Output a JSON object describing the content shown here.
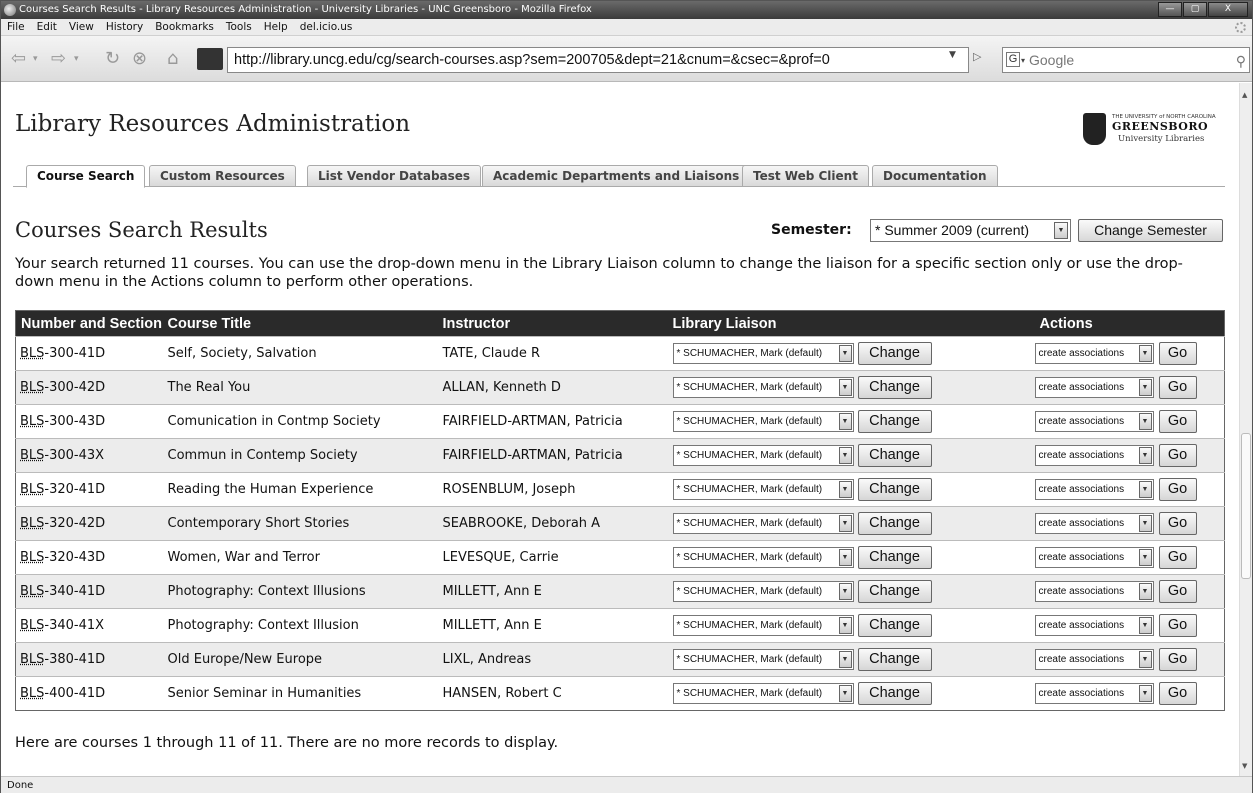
{
  "window": {
    "title": "Courses Search Results - Library Resources Administration - University Libraries - UNC Greensboro - Mozilla Firefox",
    "min": "—",
    "max": "▢",
    "close": "X"
  },
  "menu": [
    "File",
    "Edit",
    "View",
    "History",
    "Bookmarks",
    "Tools",
    "Help",
    "del.icio.us"
  ],
  "nav": {
    "back": "⇦",
    "forward": "⇨",
    "reload": "↻",
    "stop": "⊗",
    "home": "⌂",
    "url": "http://library.uncg.edu/cg/search-courses.asp?sem=200705&dept=21&cnum=&csec=&prof=0",
    "search_placeholder": "Google",
    "search_engine_icon": "G",
    "search_icon": "⚲"
  },
  "header": {
    "site_title": "Library Resources Administration",
    "logo": {
      "university": "THE UNIVERSITY of NORTH CAROLINA",
      "name": "GREENSBORO",
      "sub": "University Libraries"
    }
  },
  "tabs": [
    {
      "label": "Course Search",
      "active": true
    },
    {
      "label": "Custom Resources",
      "active": false
    },
    {
      "label": "List Vendor Databases",
      "active": false
    },
    {
      "label": "Academic Departments and Liaisons",
      "active": false
    },
    {
      "label": "Test Web Client",
      "active": false
    },
    {
      "label": "Documentation",
      "active": false
    }
  ],
  "page": {
    "heading": "Courses Search Results",
    "semester_label": "Semester:",
    "semester_value": "* Summer 2009 (current)",
    "change_semester": "Change Semester",
    "intro": "Your search returned 11 courses. You can use the drop-down menu in the Library Liaison column to change the liaison for a specific section only or use the drop-down menu in the Actions column to perform other operations.",
    "footer": "Here are courses 1 through 11 of 11. There are no more records to display."
  },
  "table": {
    "headers": [
      "Number and Section",
      "Course Title",
      "Instructor",
      "Library Liaison",
      "Actions"
    ],
    "liaison_value": "* SCHUMACHER, Mark (default)",
    "change_label": "Change",
    "action_value": "create associations",
    "go_label": "Go",
    "rows": [
      {
        "prefix": "BLS",
        "rest": "-300-41D",
        "title": "Self, Society, Salvation",
        "instructor": "TATE, Claude R"
      },
      {
        "prefix": "BLS",
        "rest": "-300-42D",
        "title": "The Real You",
        "instructor": "ALLAN, Kenneth D"
      },
      {
        "prefix": "BLS",
        "rest": "-300-43D",
        "title": "Comunication in Contmp Society",
        "instructor": "FAIRFIELD-ARTMAN, Patricia"
      },
      {
        "prefix": "BLS",
        "rest": "-300-43X",
        "title": "Commun in Contemp Society",
        "instructor": "FAIRFIELD-ARTMAN, Patricia"
      },
      {
        "prefix": "BLS",
        "rest": "-320-41D",
        "title": "Reading the Human Experience",
        "instructor": "ROSENBLUM, Joseph"
      },
      {
        "prefix": "BLS",
        "rest": "-320-42D",
        "title": "Contemporary Short Stories",
        "instructor": "SEABROOKE, Deborah A"
      },
      {
        "prefix": "BLS",
        "rest": "-320-43D",
        "title": "Women, War and Terror",
        "instructor": "LEVESQUE, Carrie"
      },
      {
        "prefix": "BLS",
        "rest": "-340-41D",
        "title": "Photography: Context Illusions",
        "instructor": "MILLETT, Ann E"
      },
      {
        "prefix": "BLS",
        "rest": "-340-41X",
        "title": "Photography: Context Illusion",
        "instructor": "MILLETT, Ann E"
      },
      {
        "prefix": "BLS",
        "rest": "-380-41D",
        "title": "Old Europe/New Europe",
        "instructor": "LIXL, Andreas"
      },
      {
        "prefix": "BLS",
        "rest": "-400-41D",
        "title": "Senior Seminar in Humanities",
        "instructor": "HANSEN, Robert C"
      }
    ]
  },
  "status": "Done"
}
